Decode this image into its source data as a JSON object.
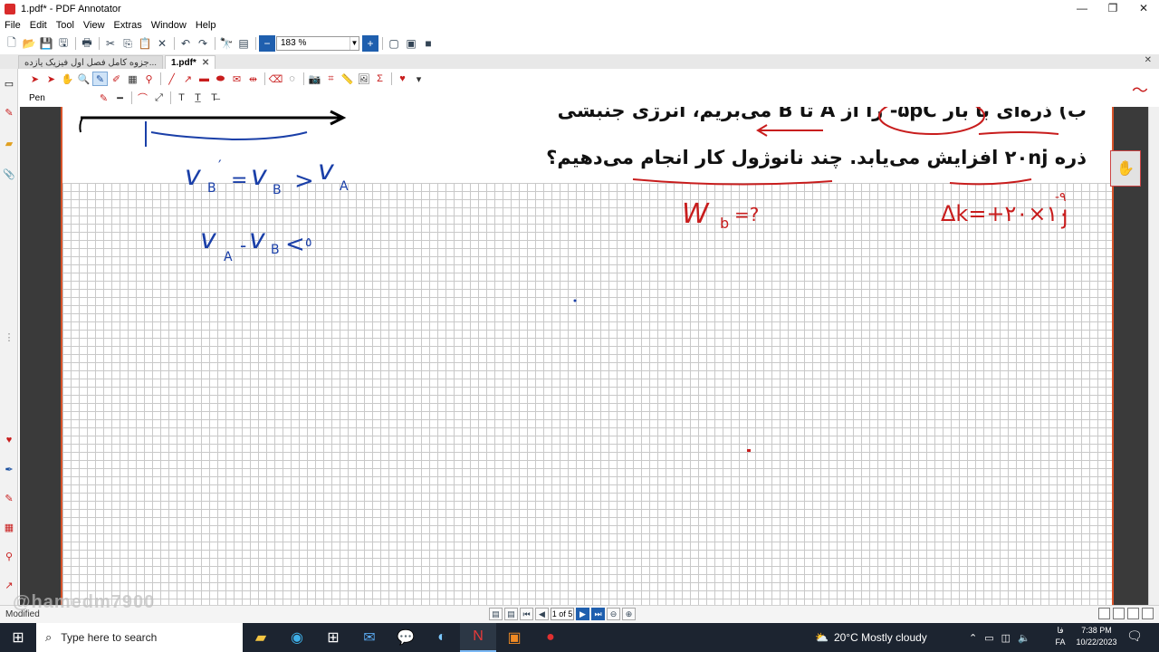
{
  "window": {
    "title": "1.pdf* - PDF Annotator",
    "minimize": "—",
    "maximize": "❐",
    "close": "✕"
  },
  "menu": [
    "File",
    "Edit",
    "Tool",
    "View",
    "Extras",
    "Window",
    "Help"
  ],
  "toolbar": {
    "zoom": "183 %"
  },
  "tabs": [
    {
      "label": "جزوه کامل فصل اول فیزیک یازده...",
      "active": false
    },
    {
      "label": "1.pdf*",
      "active": true
    }
  ],
  "annot_toolbar": {
    "tool_label": "Pen"
  },
  "document": {
    "question_line1": "ب) ذره‌ای با بار ۵pC- را از A تا B می‌بریم، انرژی جنبشی",
    "question_line2": "ذره ۲۰nj افزایش می‌یابد. چند نانوژول کار انجام می‌دهیم؟"
  },
  "status": {
    "text": "Modified",
    "page_indicator": "1 of 5",
    "watermark": "@hamedm7900"
  },
  "taskbar": {
    "search_placeholder": "Type here to search",
    "weather": "20°C  Mostly cloudy",
    "time": "7:38 PM",
    "date": "10/22/2023",
    "lang_top": "فا",
    "lang_bottom": "FA"
  },
  "colors": {
    "ink_red": "#c81d1d",
    "ink_blue": "#1a3fa8",
    "page_border": "#d9542a"
  }
}
